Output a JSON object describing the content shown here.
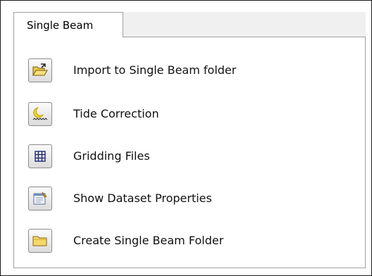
{
  "tabs": [
    {
      "label": "Single Beam",
      "active": true
    }
  ],
  "actions": [
    {
      "label": "Import to Single Beam folder",
      "icon": "open-folder-icon"
    },
    {
      "label": "Tide Correction",
      "icon": "tide-moon-icon"
    },
    {
      "label": "Gridding Files",
      "icon": "grid-icon"
    },
    {
      "label": "Show Dataset Properties",
      "icon": "properties-icon"
    },
    {
      "label": "Create Single Beam Folder",
      "icon": "folder-icon"
    }
  ]
}
